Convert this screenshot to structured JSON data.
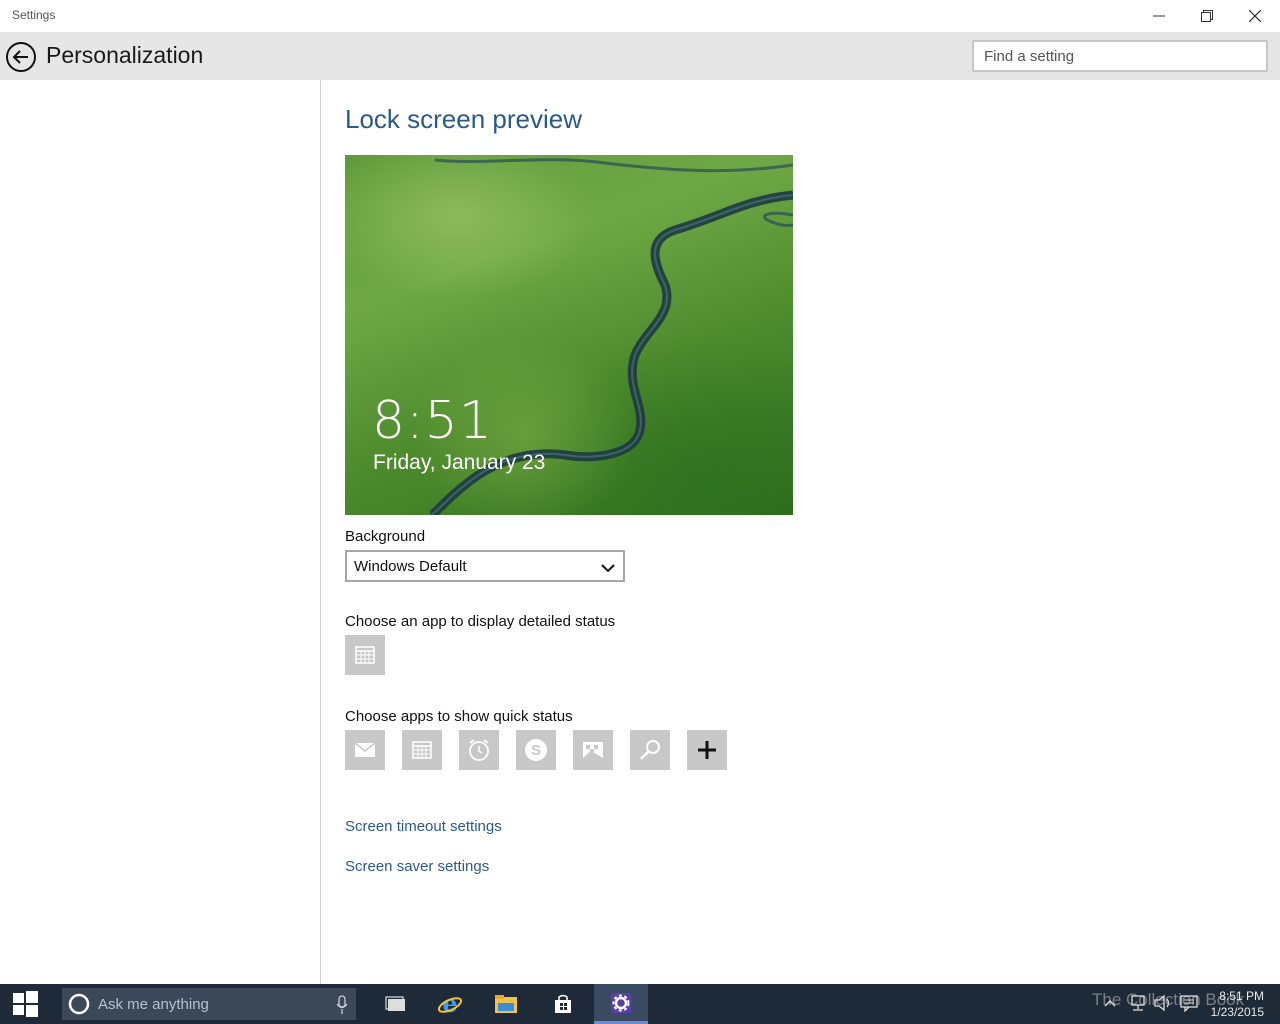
{
  "window": {
    "app_title": "Settings"
  },
  "header": {
    "page_title": "Personalization",
    "search_placeholder": "Find a setting"
  },
  "main": {
    "section_title": "Lock screen preview",
    "preview": {
      "time": "8:51",
      "date": "Friday, January 23"
    },
    "background_label": "Background",
    "background_value": "Windows Default",
    "detailed_status_label": "Choose an app to display detailed status",
    "quick_status_label": "Choose apps to show quick status",
    "quick_status_apps": [
      "mail-icon",
      "calendar-icon",
      "alarm-icon",
      "skype-icon",
      "photos-icon",
      "search-icon",
      "add-icon"
    ],
    "links": {
      "screen_timeout": "Screen timeout settings",
      "screen_saver": "Screen saver settings"
    }
  },
  "taskbar": {
    "search_placeholder": "Ask me anything",
    "watermark": "The Collection Book",
    "clock_time": "8:51 PM",
    "clock_date": "1/23/2015"
  },
  "colors": {
    "accent_link": "#2b5a8a",
    "taskbar": "#1f2a38",
    "header": "#e6e6e6"
  }
}
